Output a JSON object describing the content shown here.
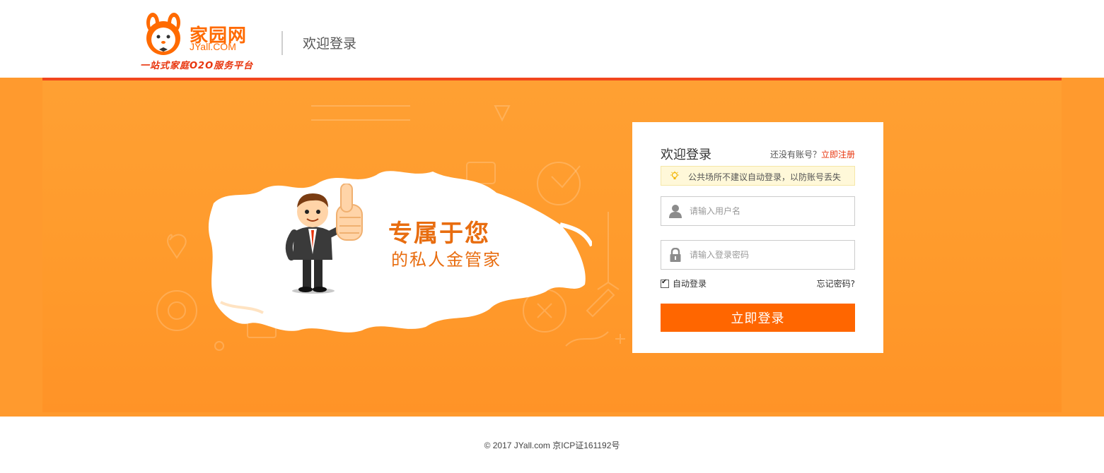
{
  "header": {
    "logo_cn": "家园网",
    "logo_en": "JYall.COM",
    "logo_slogan": "一站式家庭O2O服务平台",
    "title": "欢迎登录"
  },
  "banner": {
    "slogan_line1": "专属于您",
    "slogan_line2": "的私人金管家"
  },
  "login": {
    "title": "欢迎登录",
    "no_account_text": "还没有账号？",
    "register_link": "立即注册",
    "tip_text": "公共场所不建议自动登录，以防账号丢失",
    "username_placeholder": "请输入用户名",
    "password_placeholder": "请输入登录密码",
    "auto_login_label": "自动登录",
    "auto_login_checked": true,
    "forgot_password": "忘记密码?",
    "submit_label": "立即登录"
  },
  "footer": {
    "copyright": "© 2017 JYall.com 京ICP证161192号"
  },
  "colors": {
    "brand_orange": "#ff6600",
    "banner_bg": "#ff9a2e",
    "accent_red": "#e8340c"
  },
  "icons": {
    "tip": "lightbulb-icon",
    "username": "user-icon",
    "password": "lock-icon",
    "logo": "rabbit-logo-icon"
  }
}
